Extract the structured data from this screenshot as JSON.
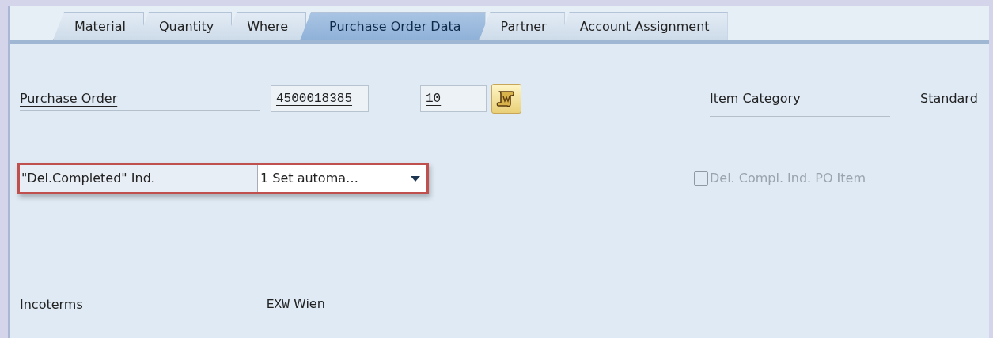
{
  "tabs": [
    {
      "label": "Material",
      "selected": false
    },
    {
      "label": "Quantity",
      "selected": false
    },
    {
      "label": "Where",
      "selected": false
    },
    {
      "label": "Purchase Order Data",
      "selected": true
    },
    {
      "label": "Partner",
      "selected": false
    },
    {
      "label": "Account Assignment",
      "selected": false
    }
  ],
  "purchase_order": {
    "label": "Purchase Order",
    "number": "4500018385",
    "item": "10"
  },
  "item_category": {
    "label": "Item Category",
    "value": "Standard"
  },
  "del_completed": {
    "label": "\"Del.Completed\" Ind.",
    "value": "1 Set automa…",
    "highlighted": true
  },
  "del_compl_po_item": {
    "label": "Del. Compl. Ind. PO Item",
    "checked": false,
    "disabled": true
  },
  "incoterms": {
    "label": "Incoterms",
    "code": "EXW",
    "place": "Wien"
  }
}
